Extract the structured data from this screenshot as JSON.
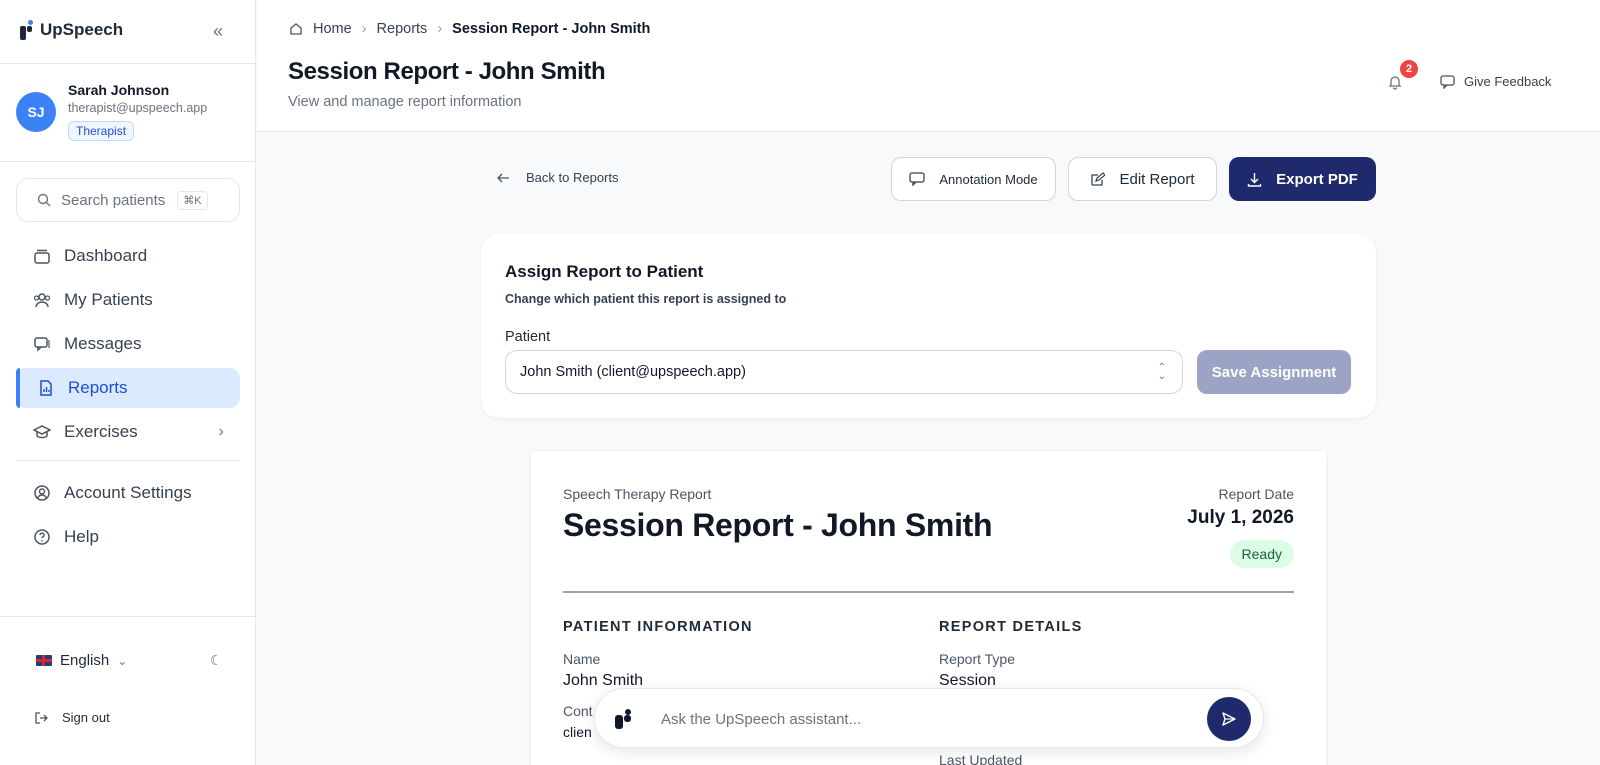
{
  "app": {
    "name": "UpSpeech"
  },
  "user": {
    "initials": "SJ",
    "name": "Sarah Johnson",
    "email": "therapist@upspeech.app",
    "role": "Therapist"
  },
  "search": {
    "placeholder": "Search patients",
    "shortcut": "⌘K"
  },
  "nav": {
    "items": [
      {
        "label": "Dashboard",
        "icon": "layers-icon"
      },
      {
        "label": "My Patients",
        "icon": "users-icon"
      },
      {
        "label": "Messages",
        "icon": "chat-icon"
      },
      {
        "label": "Reports",
        "icon": "file-chart-icon",
        "active": true
      },
      {
        "label": "Exercises",
        "icon": "graduation-cap-icon"
      }
    ],
    "secondary": [
      {
        "label": "Account Settings",
        "icon": "user-circle-icon"
      },
      {
        "label": "Help",
        "icon": "help-circle-icon"
      }
    ]
  },
  "footer": {
    "language": "English",
    "sign_out": "Sign out"
  },
  "breadcrumb": {
    "home": "Home",
    "reports": "Reports",
    "current": "Session Report - John Smith"
  },
  "header": {
    "title": "Session Report - John Smith",
    "subtitle": "View and manage report information",
    "notifications": "2",
    "feedback": "Give Feedback"
  },
  "actions": {
    "back": "Back to Reports",
    "annotation": "Annotation Mode",
    "edit": "Edit Report",
    "export": "Export PDF"
  },
  "assign": {
    "title": "Assign Report to Patient",
    "subtitle": "Change which patient this report is assigned to",
    "patient_label": "Patient",
    "patient_value": "John Smith (client@upspeech.app)",
    "save": "Save Assignment"
  },
  "report": {
    "kicker": "Speech Therapy Report",
    "title": "Session Report - John Smith",
    "date_label": "Report Date",
    "date": "July 1, 2026",
    "status": "Ready",
    "patient_section": "PATIENT INFORMATION",
    "details_section": "REPORT DETAILS",
    "name_label": "Name",
    "name_value": "John Smith",
    "contact_label": "Cont",
    "contact_value": "clien",
    "type_label": "Report Type",
    "type_value": "Session",
    "updated_label": "Last Updated"
  },
  "assistant": {
    "placeholder": "Ask the UpSpeech assistant..."
  },
  "colors": {
    "primary": "#1e2a6b",
    "accent": "#3b82f6",
    "danger": "#ef4444",
    "success_bg": "#dcfce7"
  }
}
